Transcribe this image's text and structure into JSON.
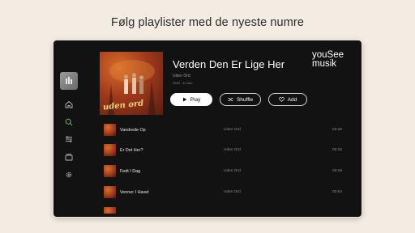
{
  "headline": "Følg playlister med de nyeste numre",
  "sidebar": {
    "items": [
      {
        "icon": "home-icon"
      },
      {
        "icon": "search-icon",
        "active": true
      },
      {
        "icon": "filter-icon"
      },
      {
        "icon": "library-icon"
      },
      {
        "icon": "settings-icon"
      }
    ]
  },
  "album": {
    "title": "Verden Den Er Lige Her",
    "artist": "Uden Ord",
    "meta": "2020 · 12 min",
    "cover_text": "uden ord"
  },
  "actions": {
    "play_label": "Play",
    "shuffle_label": "Shuffle",
    "add_label": "Add"
  },
  "brand": {
    "line1": "youSee",
    "line2": "musik"
  },
  "tracks": [
    {
      "name": "Vandrede Op",
      "artist": "Uden Ord",
      "duration": "03:30"
    },
    {
      "name": "Er Det Her?",
      "artist": "Uden Ord",
      "duration": "02:15"
    },
    {
      "name": "Fedt I Dag",
      "artist": "Uden Ord",
      "duration": "03:18"
    },
    {
      "name": "Venner I Havet",
      "artist": "Uden Ord",
      "duration": "03:54"
    }
  ],
  "colors": {
    "background": "#f2ece2",
    "panel": "#121212",
    "accent": "#5fbf5f"
  }
}
